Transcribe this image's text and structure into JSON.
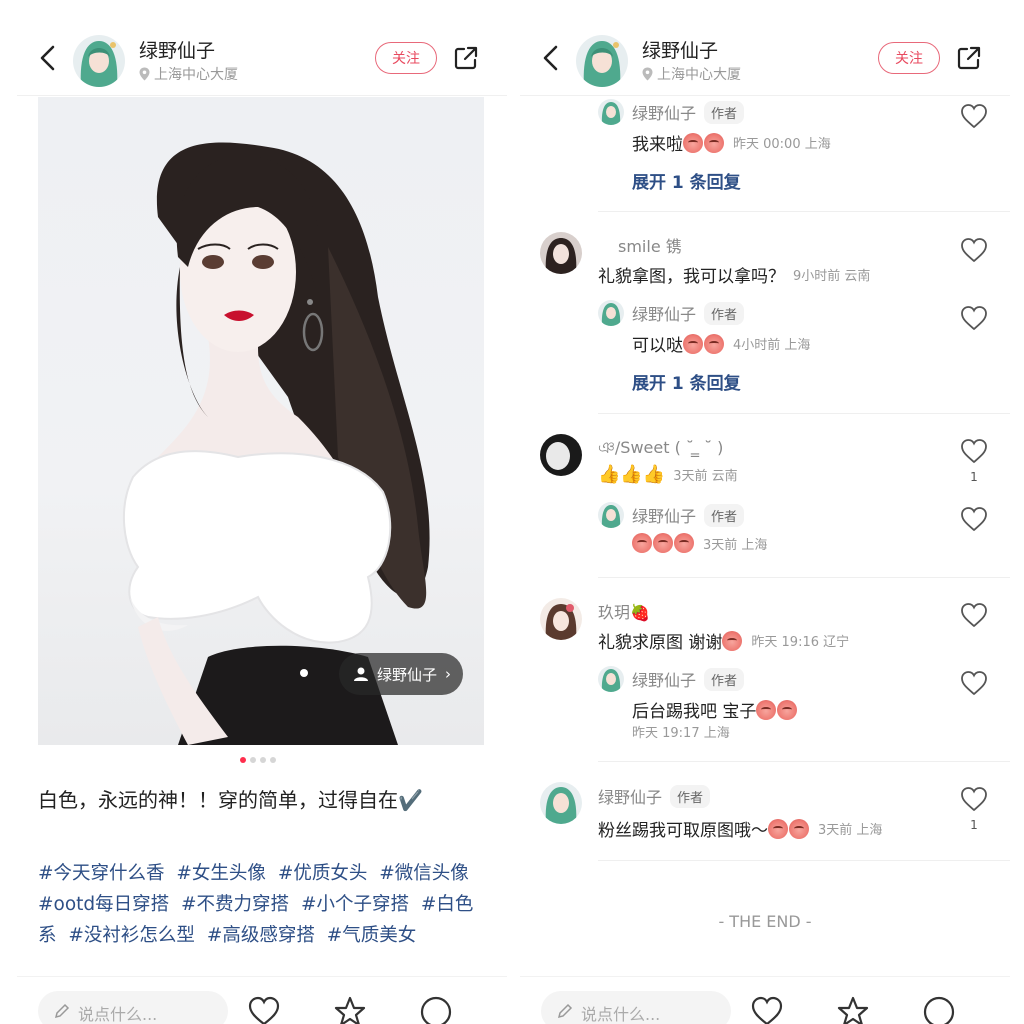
{
  "header": {
    "name": "绿野仙子",
    "location": "上海中心大厦",
    "follow_label": "关注"
  },
  "post": {
    "image_tag": "绿野仙子",
    "title": "白色，永远的神！！穿的简单，过得自在✔️",
    "tags": [
      "#今天穿什么香",
      "#女生头像",
      "#优质女头",
      "#微信头像",
      "#ootd每日穿搭",
      "#不费力穿搭",
      "#小个子穿搭",
      "#白色系",
      "#没衬衫怎么型",
      "#高级感穿搭",
      "#气质美女"
    ],
    "comment_placeholder": "说点什么..."
  },
  "colors": {
    "accent": "#ff2e4d",
    "link": "#2e4f86",
    "follow": "#e84a5f"
  },
  "comments": {
    "author_badge": "作者",
    "c0_reply": {
      "name": "绿野仙子",
      "text": "我来啦",
      "meta": "昨天 00:00 上海",
      "expand": "展开 1 条回复"
    },
    "c1": {
      "name": "smile  镌",
      "text": "礼貌拿图，我可以拿吗？",
      "meta": "9小时前 云南"
    },
    "c1_reply": {
      "name": "绿野仙子",
      "text": "可以哒",
      "meta": "4小时前 上海",
      "expand": "展开 1 条回复"
    },
    "c2": {
      "name": "ঞ/Sweet ( ˘ ̳ ˘ )",
      "text": "",
      "meta": "3天前 云南",
      "likes": "1"
    },
    "c2_reply": {
      "name": "绿野仙子",
      "meta": "3天前 上海"
    },
    "c3": {
      "name": "玖玥🍓",
      "text": "礼貌求原图 谢谢",
      "meta": "昨天 19:16 辽宁"
    },
    "c3_reply": {
      "name": "绿野仙子",
      "text": "后台踢我吧 宝子",
      "meta": "昨天 19:17 上海"
    },
    "c4": {
      "name": "绿野仙子",
      "text": "粉丝踢我可取原图哦～",
      "meta": "3天前 上海",
      "likes": "1"
    }
  },
  "end_text": "- THE END -",
  "icons": [
    "back-arrow-icon",
    "location-pin-icon",
    "share-icon",
    "heart-icon",
    "star-icon",
    "comment-icon",
    "person-icon",
    "pen-icon"
  ]
}
